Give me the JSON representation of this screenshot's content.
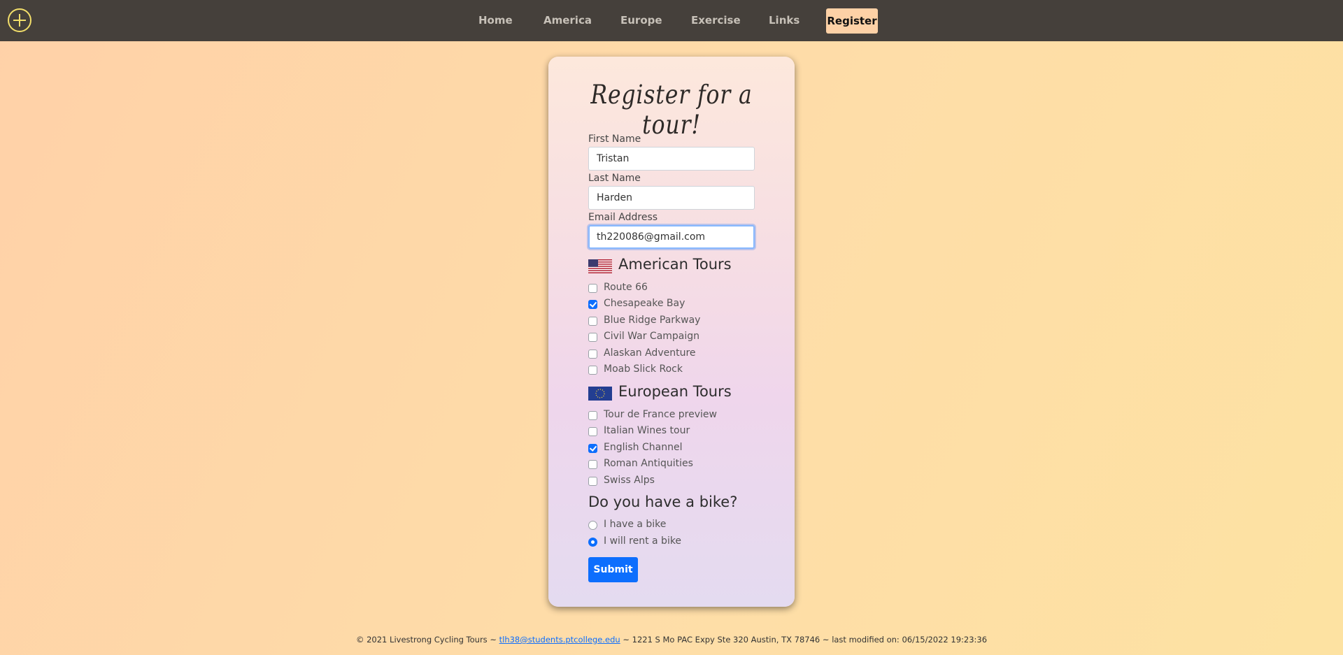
{
  "nav": {
    "logo_icon": "plus-circle-icon",
    "items": [
      "Home",
      "America",
      "Europe",
      "Exercise",
      "Links"
    ],
    "register_label": "Register"
  },
  "form": {
    "title": "Register for a tour!",
    "first_name": {
      "label": "First Name",
      "value": "Tristan"
    },
    "last_name": {
      "label": "Last Name",
      "value": "Harden"
    },
    "email": {
      "label": "Email Address",
      "value": "th220086@gmail.com"
    },
    "american": {
      "title": "American Tours",
      "flag_icon": "us-flag-icon",
      "tours": [
        {
          "label": "Route 66",
          "checked": false
        },
        {
          "label": "Chesapeake Bay",
          "checked": true
        },
        {
          "label": "Blue Ridge Parkway",
          "checked": false
        },
        {
          "label": "Civil War Campaign",
          "checked": false
        },
        {
          "label": "Alaskan Adventure",
          "checked": false
        },
        {
          "label": "Moab Slick Rock",
          "checked": false
        }
      ]
    },
    "european": {
      "title": "European Tours",
      "flag_icon": "eu-flag-icon",
      "tours": [
        {
          "label": "Tour de France preview",
          "checked": false
        },
        {
          "label": "Italian Wines tour",
          "checked": false
        },
        {
          "label": "English Channel",
          "checked": true
        },
        {
          "label": "Roman Antiquities",
          "checked": false
        },
        {
          "label": "Swiss Alps",
          "checked": false
        }
      ]
    },
    "bike": {
      "title": "Do you have a bike?",
      "options": [
        {
          "label": "I have a bike",
          "checked": false
        },
        {
          "label": "I will rent a bike",
          "checked": true
        }
      ]
    },
    "submit_label": "Submit"
  },
  "footer": {
    "prefix": "© 2021 Livestrong Cycling Tours ~ ",
    "email": "tlh38@students.ptcollege.edu",
    "suffix": " ~ 1221 S Mo PAC Expy Ste 320 Austin, TX 78746 ~ last modified on: 06/15/2022 19:23:36"
  },
  "colors": {
    "nav_bg": "#45403b",
    "accent": "#0d6efd",
    "register_bg": "#fdd1a6",
    "logo": "#f3df6a"
  }
}
